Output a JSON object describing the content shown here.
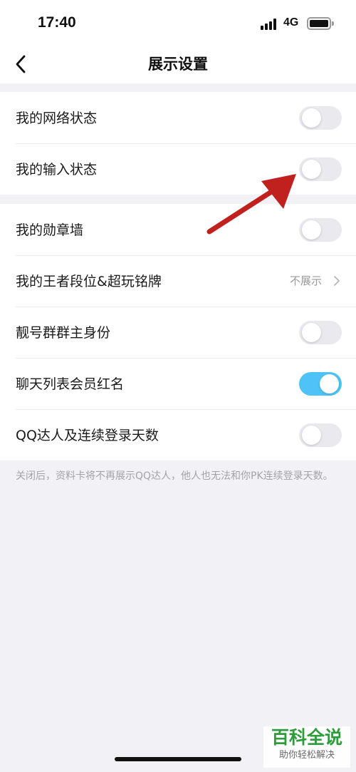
{
  "status_bar": {
    "time": "17:40",
    "network": "4G",
    "signal_icon": "signal-bars-icon",
    "battery_icon": "battery-icon"
  },
  "nav": {
    "back_icon": "chevron-left-icon",
    "title": "展示设置"
  },
  "group1": {
    "rows": [
      {
        "label": "我的网络状态",
        "toggle": false
      },
      {
        "label": "我的输入状态",
        "toggle": false
      }
    ]
  },
  "group2": {
    "rows": [
      {
        "label": "我的勋章墙",
        "toggle": false
      },
      {
        "label": "我的王者段位&超玩铭牌",
        "value": "不展示"
      },
      {
        "label": "靓号群群主身份",
        "toggle": false
      },
      {
        "label": "聊天列表会员红名",
        "toggle": true
      },
      {
        "label": "QQ达人及连续登录天数",
        "toggle": false
      }
    ]
  },
  "footnote": "关闭后，资料卡将不再展示QQ达人，他人也无法和你PK连续登录天数。",
  "annotation": {
    "arrow_color": "#c0201e",
    "points_to": "我的输入状态"
  },
  "colors": {
    "toggle_on": "#4fc3f7",
    "toggle_off": "#e9e9ee",
    "background": "#f2f2f6"
  },
  "watermark": {
    "main": "百科全说",
    "sub": "助你轻松解决"
  }
}
